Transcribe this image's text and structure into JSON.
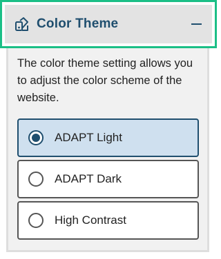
{
  "header": {
    "title": "Color Theme",
    "icon": "palette-icon",
    "collapse_icon": "minus-icon"
  },
  "description": "The color theme setting allows you to adjust the color scheme of the website.",
  "options": [
    {
      "label": "ADAPT Light",
      "selected": true
    },
    {
      "label": "ADAPT Dark",
      "selected": false
    },
    {
      "label": "High Contrast",
      "selected": false
    }
  ],
  "colors": {
    "accent": "#1f4e6e",
    "focus_outline": "#1bbf86",
    "selected_bg": "#cfe0ef"
  }
}
